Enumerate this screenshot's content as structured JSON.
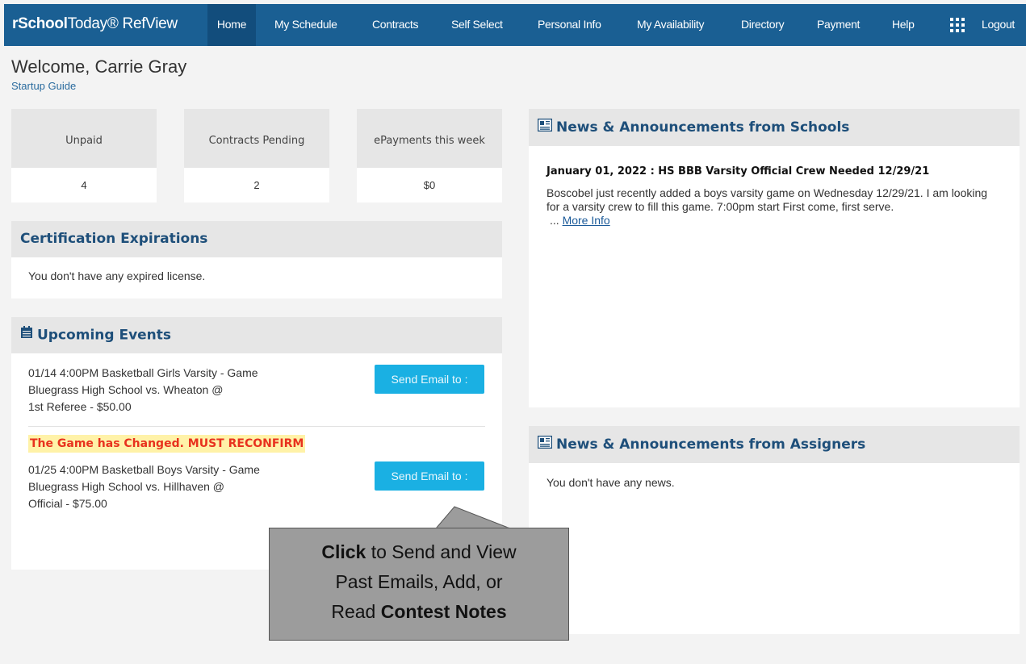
{
  "app": {
    "brand_bold": "rSchool",
    "brand_rest": "Today® RefView"
  },
  "nav": {
    "items": [
      {
        "label": "Home",
        "active": true
      },
      {
        "label": "My Schedule"
      },
      {
        "label": "Contracts"
      },
      {
        "label": "Self Select"
      },
      {
        "label": "Personal Info"
      },
      {
        "label": "My Availability"
      },
      {
        "label": "Directory"
      },
      {
        "label": "Payment"
      },
      {
        "label": "Help"
      }
    ],
    "apps_icon": "grid-icon",
    "logout": "Logout"
  },
  "header": {
    "welcome": "Welcome, Carrie Gray",
    "startup_link": "Startup Guide"
  },
  "stats": [
    {
      "label": "Unpaid",
      "value": "4"
    },
    {
      "label": "Contracts Pending",
      "value": "2"
    },
    {
      "label": "ePayments this week",
      "value": "$0"
    }
  ],
  "certifications": {
    "title": "Certification Expirations",
    "message": "You don't have any expired license."
  },
  "upcoming": {
    "title": "Upcoming Events",
    "icon": "calendar-icon",
    "events": [
      {
        "line1": "01/14 4:00PM Basketball Girls Varsity - Game",
        "line2": "Bluegrass High School vs. Wheaton @",
        "line3": "1st Referee - $50.00",
        "button": "Send Email to :"
      },
      {
        "notice": "The Game has Changed. MUST RECONFIRM",
        "line1": "01/25 4:00PM Basketball Boys Varsity - Game",
        "line2": "Bluegrass High School vs. Hillhaven @",
        "line3": "Official - $75.00",
        "button": "Send Email to :"
      }
    ]
  },
  "schools_news": {
    "title": "News & Announcements from Schools",
    "icon": "newspaper-icon",
    "item_title": "January 01, 2022 : HS BBB Varsity Official Crew Needed 12/29/21",
    "item_body": "Boscobel just recently added a boys varsity game on Wednesday 12/29/21.   I am looking for a varsity crew to fill this game.   7:00pm start First come, first serve.",
    "ellipsis": "...",
    "more_link": "More Info"
  },
  "assigners_news": {
    "title": "News & Announcements from Assigners",
    "icon": "newspaper-icon",
    "message": "You don't have any news."
  },
  "callout": {
    "bold1": "Click",
    "text1": " to Send and View",
    "text2": "Past Emails, Add, or",
    "text3": "Read ",
    "bold2": "Contest Notes"
  }
}
